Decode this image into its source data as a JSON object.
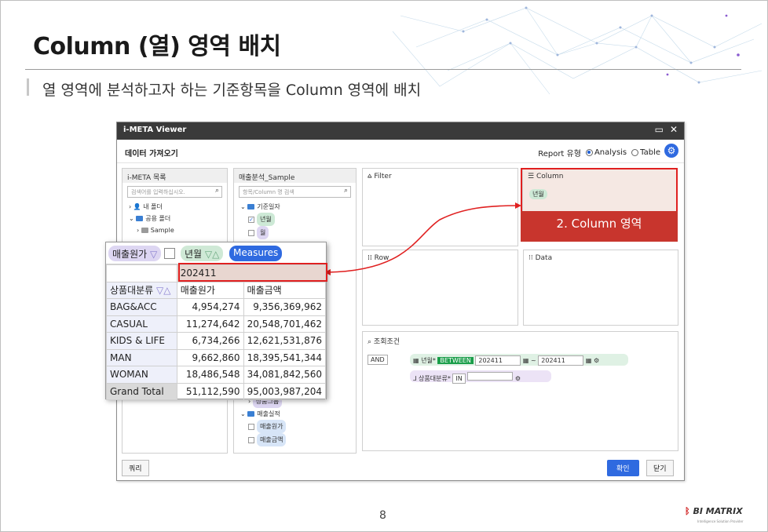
{
  "slide": {
    "title": "Column (열) 영역 배치",
    "subtitle": "열 영역에 분석하고자 하는 기준항목을 Column 영역에 배치",
    "page_number": "8",
    "logo": "BI MATRIX",
    "logo_tagline": "Intelligence Solution Provider"
  },
  "window": {
    "title": "i-META Viewer",
    "header_title": "데이터 가져오기",
    "report_type_label": "Report 유형",
    "radio_analysis": "Analysis",
    "radio_table": "Table",
    "meta_panel": {
      "title": "i-META 목록",
      "search_placeholder": "검색어를 입력하십시오.",
      "items": [
        "내 폴더",
        "공용 폴더",
        "Sample"
      ]
    },
    "sample_panel": {
      "title": "매출분석_Sample",
      "search_placeholder": "항목/Column 명 검색",
      "items": [
        "기준일자",
        "년월",
        "월",
        "상품그룹",
        "매출실적",
        "매출원가",
        "매출금액"
      ]
    },
    "filter_label": "Filter",
    "column_label": "Column",
    "column_item": "년월",
    "row_label": "Row",
    "data_label": "Data",
    "conditions": {
      "title": "조회조건",
      "and_label": "AND",
      "cond1_field": "년월*",
      "cond1_op": "BETWEEN",
      "cond1_from": "202411",
      "cond1_tilde": "~",
      "cond1_to": "202411",
      "cond2_field": "상품대분류*",
      "cond2_op": "IN"
    },
    "query_button": "쿼리",
    "ok_button": "확인",
    "close_button": "닫기"
  },
  "annotation": {
    "column_area_label": "2. Column 영역"
  },
  "pivot": {
    "chip_cost": "매출원가",
    "chip_yearmonth": "년월",
    "chip_measures": "Measures",
    "year_value": "202411",
    "row_header": "상품대분류",
    "col_cost": "매출원가",
    "col_sales": "매출금액",
    "rows": [
      {
        "label": "BAG&ACC",
        "cost": "4,954,274",
        "sales": "9,356,369,962"
      },
      {
        "label": "CASUAL",
        "cost": "11,274,642",
        "sales": "20,548,701,462"
      },
      {
        "label": "KIDS & LIFE",
        "cost": "6,734,266",
        "sales": "12,621,531,876"
      },
      {
        "label": "MAN",
        "cost": "9,662,860",
        "sales": "18,395,541,344"
      },
      {
        "label": "WOMAN",
        "cost": "18,486,548",
        "sales": "34,081,842,560"
      }
    ],
    "total": {
      "label": "Grand Total",
      "cost": "51,112,590",
      "sales": "95,003,987,204"
    }
  }
}
